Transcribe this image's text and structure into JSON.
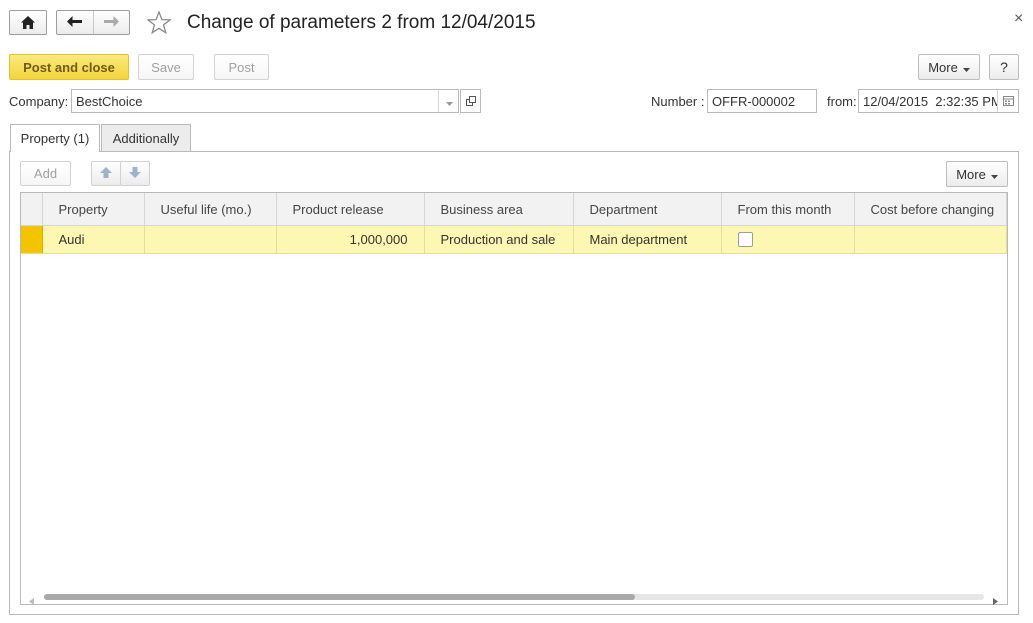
{
  "window": {
    "title": "Change of parameters 2 from 12/04/2015",
    "close_glyph": "×"
  },
  "nav": {
    "home_icon": "home-icon",
    "back_icon": "arrow-left-icon",
    "forward_icon": "arrow-right-icon",
    "favorite_icon": "star-icon"
  },
  "toolbar": {
    "post_and_close": "Post and close",
    "save": "Save",
    "post": "Post",
    "more": "More",
    "help": "?"
  },
  "form": {
    "company_label": "Company:",
    "company_value": "BestChoice",
    "number_label": "Number :",
    "number_value": "OFFR-000002",
    "from_label": "from:",
    "date_value": "12/04/2015  2:32:35 PM"
  },
  "tabs": [
    {
      "label": "Property (1)",
      "active": true
    },
    {
      "label": "Additionally",
      "active": false
    }
  ],
  "table_toolbar": {
    "add": "Add",
    "more": "More"
  },
  "table": {
    "columns": [
      "Property",
      "Useful life (mo.)",
      "Product release",
      "Business area",
      "Department",
      "From this month",
      "Cost before changing"
    ],
    "rows": [
      {
        "property": "Audi",
        "useful_life": "",
        "product_release": "1,000,000",
        "business_area": "Production and sale",
        "department": "Main department",
        "from_this_month": false,
        "cost_before_changing": ""
      }
    ]
  },
  "colors": {
    "accent_yellow": "#f3d53a",
    "row_highlight": "#fdf7b4",
    "row_marker": "#f5c400"
  }
}
